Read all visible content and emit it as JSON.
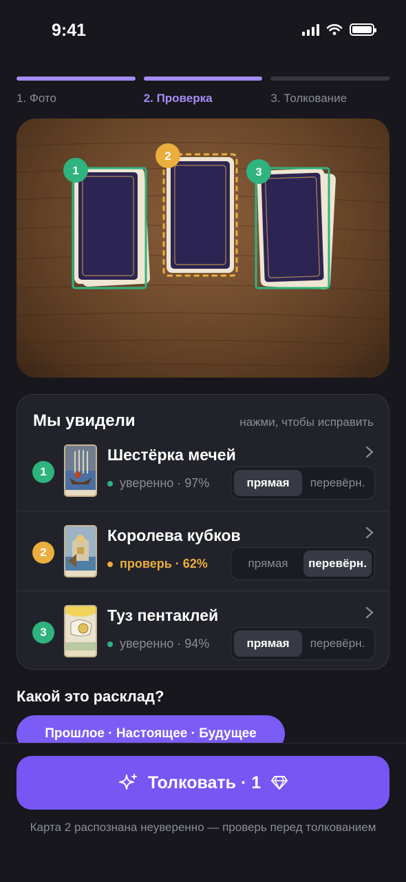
{
  "status_bar": {
    "time": "9:41"
  },
  "steps": [
    {
      "label": "1. Фото",
      "state": "done"
    },
    {
      "label": "2. Проверка",
      "state": "current"
    },
    {
      "label": "3. Толкование",
      "state": "todo"
    }
  ],
  "photo": {
    "markers": [
      "1",
      "2",
      "3"
    ]
  },
  "recognized": {
    "title": "Мы увидели",
    "hint": "нажми, чтобы исправить",
    "cards": [
      {
        "number": "1",
        "name": "Шестёрка мечей",
        "status": "уверенно · 97%",
        "confidence": 97,
        "status_level": "ok",
        "options": [
          "прямая",
          "перевёрн."
        ],
        "selected": "прямая"
      },
      {
        "number": "2",
        "name": "Королева кубков",
        "status": "проверь · 62%",
        "confidence": 62,
        "status_level": "warn",
        "options": [
          "прямая",
          "перевёрн."
        ],
        "selected": "перевёрн."
      },
      {
        "number": "3",
        "name": "Туз пентаклей",
        "status": "уверенно · 94%",
        "confidence": 94,
        "status_level": "ok",
        "options": [
          "прямая",
          "перевёрн."
        ],
        "selected": "прямая"
      }
    ]
  },
  "spread": {
    "question": "Какой это расклад?",
    "selected": "Прошлое · Настоящее · Будущее"
  },
  "cta": {
    "label": "Толковать · 1"
  },
  "footer_note": "Карта 2 распознана неуверенно — проверь перед толкованием",
  "colors": {
    "accent": "#7756f3",
    "accent_light": "#a58cf5",
    "ok": "#2fb37f",
    "warn": "#e9ae3c"
  },
  "icons": {
    "cta_left": "sparkle-icon",
    "cta_right": "gem-icon",
    "row_right": "chevron-right-icon"
  }
}
